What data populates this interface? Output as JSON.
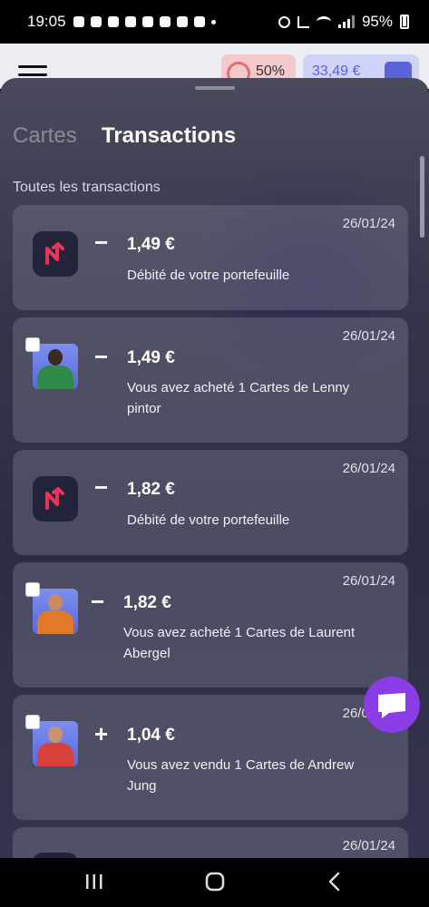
{
  "status_bar": {
    "time": "19:05",
    "battery": "95%"
  },
  "app_header": {
    "indicator_percent": "50%",
    "balance": "33,49 €"
  },
  "sheet": {
    "tabs": [
      {
        "label": "Cartes",
        "active": false
      },
      {
        "label": "Transactions",
        "active": true
      }
    ],
    "section_label": "Toutes les transactions",
    "transactions": [
      {
        "date": "26/01/24",
        "sign": "−",
        "amount": "1,49 €",
        "description": "Débité de votre portefeuille",
        "icon": "app-logo-icon"
      },
      {
        "date": "26/01/24",
        "sign": "−",
        "amount": "1,49 €",
        "description": "Vous avez acheté 1 Cartes de Lenny pintor",
        "icon": "player-avatar-icon"
      },
      {
        "date": "26/01/24",
        "sign": "−",
        "amount": "1,82 €",
        "description": "Débité de votre portefeuille",
        "icon": "app-logo-icon"
      },
      {
        "date": "26/01/24",
        "sign": "−",
        "amount": "1,82 €",
        "description": "Vous avez acheté 1 Cartes de Laurent Abergel",
        "icon": "player-avatar-icon"
      },
      {
        "date": "26/01/24",
        "sign": "+",
        "amount": "1,04 €",
        "description": "Vous avez vendu 1 Cartes de Andrew Jung",
        "icon": "player-avatar-icon"
      },
      {
        "date": "26/01/24",
        "sign": "",
        "amount": "",
        "description": "",
        "icon": "app-logo-icon"
      }
    ]
  },
  "colors": {
    "accent_purple": "#8a3de6",
    "brand_red": "#e8345a",
    "balance_blue": "#5b63d9"
  }
}
